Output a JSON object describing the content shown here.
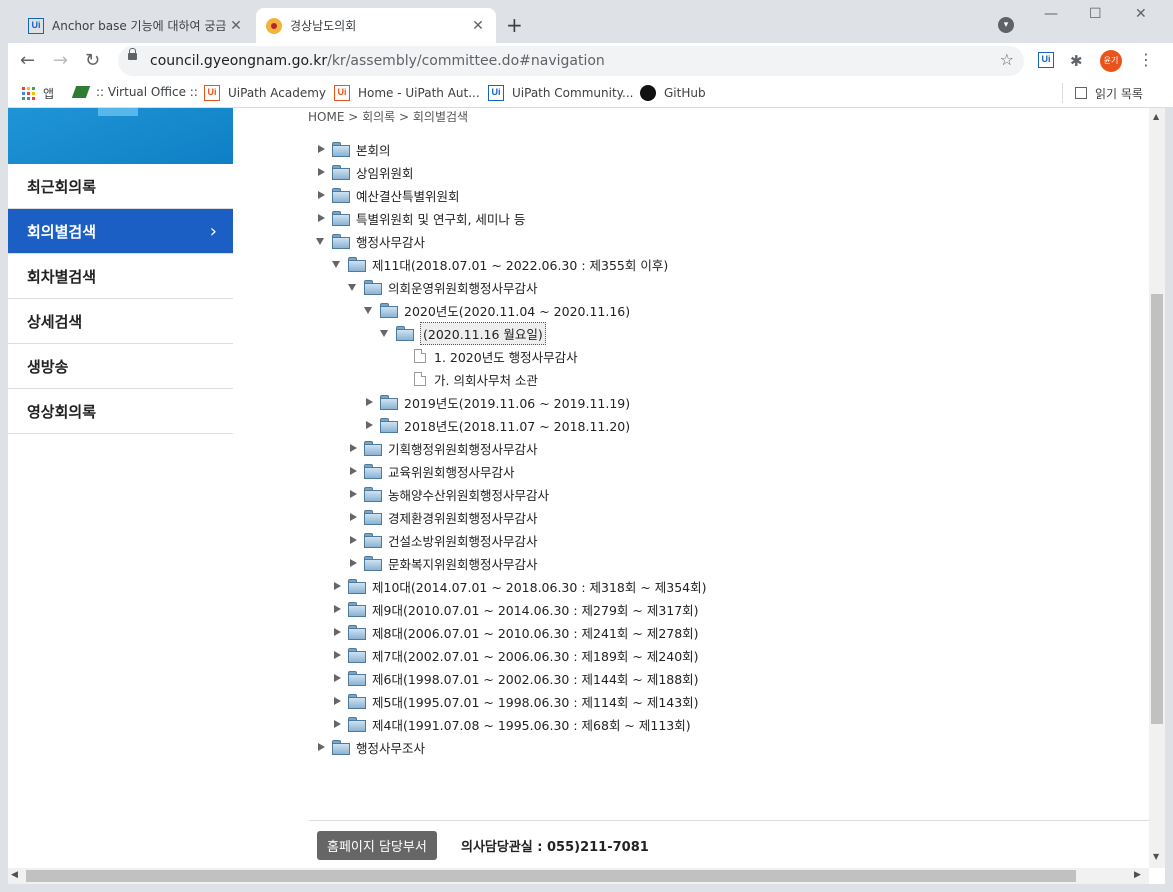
{
  "tabs": [
    {
      "title": "Anchor base 기능에 대하여 궁금",
      "icon": "uipath-icon",
      "close": "✕"
    },
    {
      "title": "경상남도의회",
      "icon": "council-seal-icon",
      "close": "✕"
    }
  ],
  "new_tab": "+",
  "url": {
    "host": "council.gyeongnam.go.kr",
    "path": "/kr/assembly/committee.do#navigation"
  },
  "avatar_text": "윤기",
  "bookmarks": [
    {
      "label": "앱",
      "icon": "apps-grid-icon"
    },
    {
      "label": ":: Virtual Office ::",
      "icon": "virtual-office-icon"
    },
    {
      "label": "UiPath Academy",
      "icon": "uipath-icon"
    },
    {
      "label": "Home - UiPath Aut...",
      "icon": "uipath-icon"
    },
    {
      "label": "UiPath Community...",
      "icon": "uipath-icon"
    },
    {
      "label": "GitHub",
      "icon": "github-icon"
    }
  ],
  "reading_list": "읽기 목록",
  "breadcrumb": "HOME > 회의록 > 회의별검색",
  "sidebar": [
    {
      "label": "최근회의록",
      "active": false
    },
    {
      "label": "회의별검색",
      "active": true
    },
    {
      "label": "회차별검색",
      "active": false
    },
    {
      "label": "상세검색",
      "active": false
    },
    {
      "label": "생방송",
      "active": false
    },
    {
      "label": "영상회의록",
      "active": false
    }
  ],
  "sidebar_chevron": "›",
  "tree": [
    {
      "label": "본회의",
      "level": 0,
      "state": "closed",
      "kind": "folder"
    },
    {
      "label": "상임위원회",
      "level": 0,
      "state": "closed",
      "kind": "folder"
    },
    {
      "label": "예산결산특별위원회",
      "level": 0,
      "state": "closed",
      "kind": "folder"
    },
    {
      "label": "특별위원회 및 연구회, 세미나 등",
      "level": 0,
      "state": "closed",
      "kind": "folder"
    },
    {
      "label": "행정사무감사",
      "level": 0,
      "state": "open",
      "kind": "folder"
    },
    {
      "label": "제11대(2018.07.01 ~ 2022.06.30 : 제355회 이후)",
      "level": 1,
      "state": "open",
      "kind": "folder"
    },
    {
      "label": "의회운영위원회행정사무감사",
      "level": 2,
      "state": "open",
      "kind": "folder"
    },
    {
      "label": "2020년도(2020.11.04 ~ 2020.11.16)",
      "level": 3,
      "state": "open",
      "kind": "folder"
    },
    {
      "label": "(2020.11.16 월요일)",
      "level": 4,
      "state": "open",
      "kind": "folder",
      "selected": true
    },
    {
      "label": "1. 2020년도 행정사무감사",
      "level": 5,
      "state": "none",
      "kind": "file"
    },
    {
      "label": "가. 의회사무처 소관",
      "level": 5,
      "state": "none",
      "kind": "file"
    },
    {
      "label": "2019년도(2019.11.06 ~ 2019.11.19)",
      "level": 3,
      "state": "closed",
      "kind": "folder"
    },
    {
      "label": "2018년도(2018.11.07 ~ 2018.11.20)",
      "level": 3,
      "state": "closed",
      "kind": "folder"
    },
    {
      "label": "기획행정위원회행정사무감사",
      "level": 2,
      "state": "closed",
      "kind": "folder"
    },
    {
      "label": "교육위원회행정사무감사",
      "level": 2,
      "state": "closed",
      "kind": "folder"
    },
    {
      "label": "농해양수산위원회행정사무감사",
      "level": 2,
      "state": "closed",
      "kind": "folder"
    },
    {
      "label": "경제환경위원회행정사무감사",
      "level": 2,
      "state": "closed",
      "kind": "folder"
    },
    {
      "label": "건설소방위원회행정사무감사",
      "level": 2,
      "state": "closed",
      "kind": "folder"
    },
    {
      "label": "문화복지위원회행정사무감사",
      "level": 2,
      "state": "closed",
      "kind": "folder"
    },
    {
      "label": "제10대(2014.07.01 ~ 2018.06.30 : 제318회 ~ 제354회)",
      "level": 1,
      "state": "closed",
      "kind": "folder"
    },
    {
      "label": "제9대(2010.07.01 ~ 2014.06.30 : 제279회 ~ 제317회)",
      "level": 1,
      "state": "closed",
      "kind": "folder"
    },
    {
      "label": "제8대(2006.07.01 ~ 2010.06.30 : 제241회 ~ 제278회)",
      "level": 1,
      "state": "closed",
      "kind": "folder"
    },
    {
      "label": "제7대(2002.07.01 ~ 2006.06.30 : 제189회 ~ 제240회)",
      "level": 1,
      "state": "closed",
      "kind": "folder"
    },
    {
      "label": "제6대(1998.07.01 ~ 2002.06.30 : 제144회 ~ 제188회)",
      "level": 1,
      "state": "closed",
      "kind": "folder"
    },
    {
      "label": "제5대(1995.07.01 ~ 1998.06.30 : 제114회 ~ 제143회)",
      "level": 1,
      "state": "closed",
      "kind": "folder"
    },
    {
      "label": "제4대(1991.07.08 ~ 1995.06.30 : 제68회 ~ 제113회)",
      "level": 1,
      "state": "closed",
      "kind": "folder"
    },
    {
      "label": "행정사무조사",
      "level": 0,
      "state": "closed",
      "kind": "folder"
    }
  ],
  "footer": {
    "dept_button": "홈페이지 담당부서",
    "contact": "의사담당관실 : 055)211-7081"
  },
  "colors": {
    "active_menu": "#1b5fc4",
    "banner": "#1f95d6",
    "tab_strip": "#dee1e6"
  }
}
